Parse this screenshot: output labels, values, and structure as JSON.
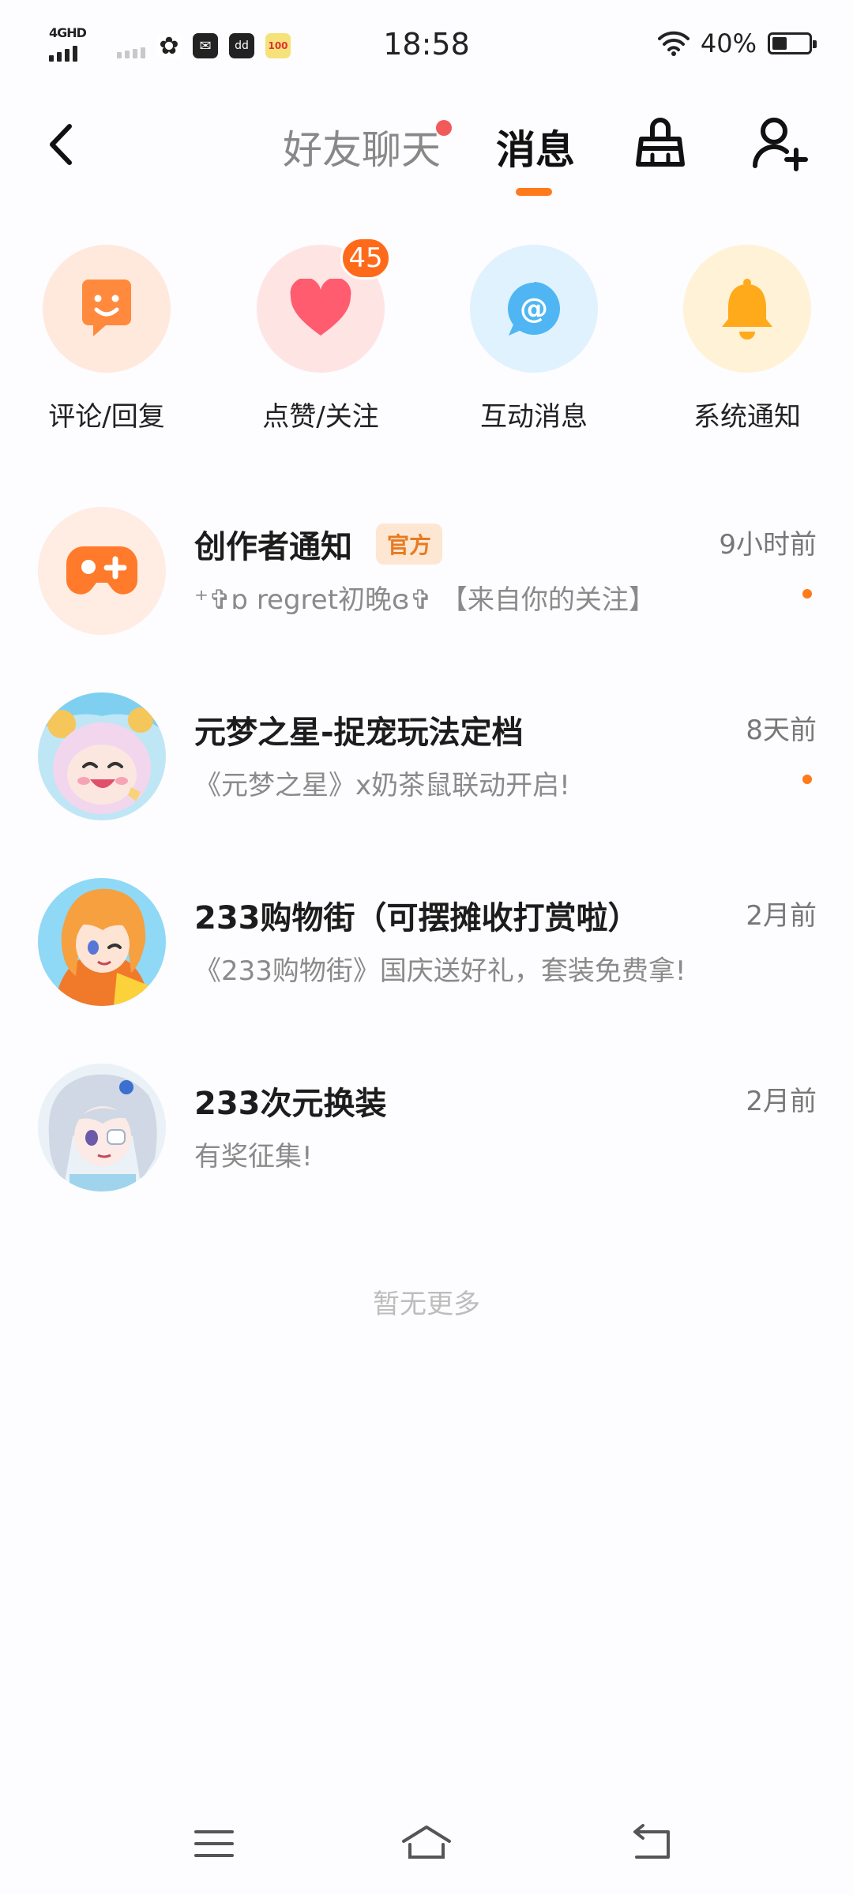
{
  "status_bar": {
    "network": "4GHD",
    "time": "18:58",
    "battery_text": "40%",
    "battery_level": 0.4
  },
  "header": {
    "tabs": [
      {
        "label": "好友聊天",
        "has_dot": true,
        "active": false
      },
      {
        "label": "消息",
        "active": true
      }
    ],
    "icons": [
      "back-arrow-icon",
      "clean-broom-icon",
      "add-user-icon"
    ],
    "accent_color": "#ff7a1a"
  },
  "shortcuts": [
    {
      "label": "评论/回复",
      "icon": "comment-smile-icon",
      "bg": "#ffe9dc",
      "color": "#ff8a3d"
    },
    {
      "label": "点赞/关注",
      "icon": "heart-icon",
      "bg": "#ffe4e4",
      "color": "#ff5c6f",
      "badge": "45"
    },
    {
      "label": "互动消息",
      "icon": "at-sign-icon",
      "bg": "#dff2fd",
      "color": "#4fb6f3"
    },
    {
      "label": "系统通知",
      "icon": "bell-icon",
      "bg": "#fff2d6",
      "color": "#ffaa1a"
    }
  ],
  "messages": [
    {
      "title": "创作者通知",
      "tag": "官方",
      "subtitle": "⁺✞ɒ regret初晚ɞ✞ 【来自你的关注】",
      "time": "9小时前",
      "unread": true,
      "avatar": "gamepad-icon"
    },
    {
      "title": "元梦之星-捉宠玩法定档",
      "subtitle": "《元梦之星》x奶茶鼠联动开启!",
      "time": "8天前",
      "unread": true,
      "avatar": "yuanmeng-character-avatar"
    },
    {
      "title": "233购物街（可摆摊收打赏啦）",
      "subtitle": "《233购物街》国庆送好礼，套装免费拿!",
      "time": "2月前",
      "unread": false,
      "avatar": "orange-hair-girl-avatar"
    },
    {
      "title": "233次元换装",
      "subtitle": "有奖征集!",
      "time": "2月前",
      "unread": false,
      "avatar": "silver-hair-girl-avatar"
    }
  ],
  "footer_text": "暂无更多",
  "nav": [
    "menu-icon",
    "home-icon",
    "back-nav-icon"
  ]
}
